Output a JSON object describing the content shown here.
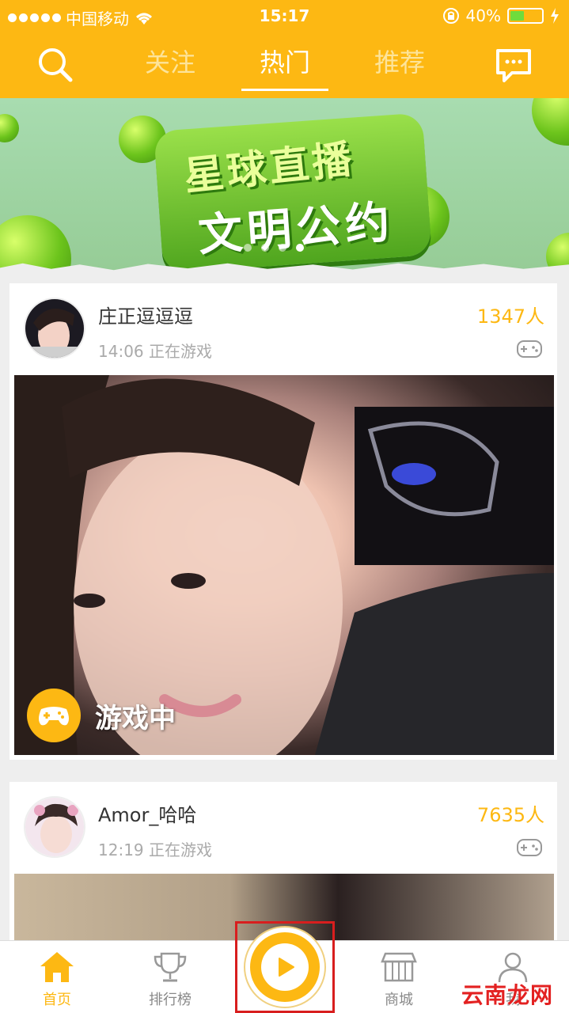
{
  "status_bar": {
    "carrier": "中国移动",
    "time": "15:17",
    "battery": "40%"
  },
  "top_nav": {
    "tabs": [
      {
        "label": "关注",
        "active": false
      },
      {
        "label": "热门",
        "active": true
      },
      {
        "label": "推荐",
        "active": false
      }
    ]
  },
  "banner": {
    "line1": "星球直播",
    "line2": "文明公约",
    "page_count": 4,
    "active_page": 4
  },
  "streams": [
    {
      "name": "庄正逗逗逗",
      "time": "14:06",
      "status": "正在游戏",
      "viewers": "1347人",
      "badge": "游戏中"
    },
    {
      "name": "Amor_哈哈",
      "time": "12:19",
      "status": "正在游戏",
      "viewers": "7635人"
    }
  ],
  "bottom_tabs": [
    {
      "label": "首页",
      "icon": "home-icon",
      "active": true
    },
    {
      "label": "排行榜",
      "icon": "trophy-icon",
      "active": false
    },
    {
      "label": "商城",
      "icon": "shop-icon",
      "active": false
    },
    {
      "label": "我",
      "icon": "profile-icon",
      "active": false
    }
  ],
  "watermark": "云南龙网",
  "colors": {
    "brand": "#fdb813",
    "highlight": "#d81e1e"
  }
}
